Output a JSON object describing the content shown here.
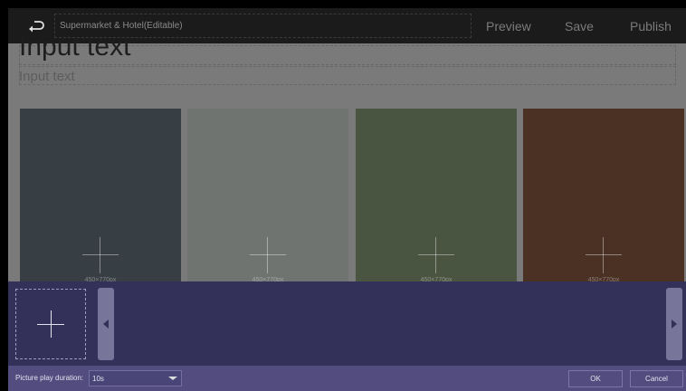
{
  "header": {
    "back_icon": "return-arrow-icon",
    "title": "Supermarket & Hotel(Editable)",
    "actions": {
      "preview": "Preview",
      "save": "Save",
      "publish": "Publish"
    }
  },
  "content": {
    "title_placeholder": "Input text",
    "subtitle_placeholder": "Input text",
    "cards": [
      {
        "size_hint": "450×770px",
        "color": "#383f44"
      },
      {
        "size_hint": "450×770px",
        "color": "#6f7471"
      },
      {
        "size_hint": "450×770px",
        "color": "#495441"
      },
      {
        "size_hint": "450×770px",
        "color": "#4a3124"
      }
    ]
  },
  "picture_panel": {
    "add_icon": "plus-icon",
    "prev_icon": "chevron-left-icon",
    "next_icon": "chevron-right-icon"
  },
  "footer": {
    "duration_label": "Picture play duration:",
    "duration_value": "10s",
    "ok_label": "OK",
    "cancel_label": "Cancel"
  },
  "colors": {
    "panel": "#333059",
    "footer": "#524d7e",
    "topbar": "#1b1b1b"
  }
}
